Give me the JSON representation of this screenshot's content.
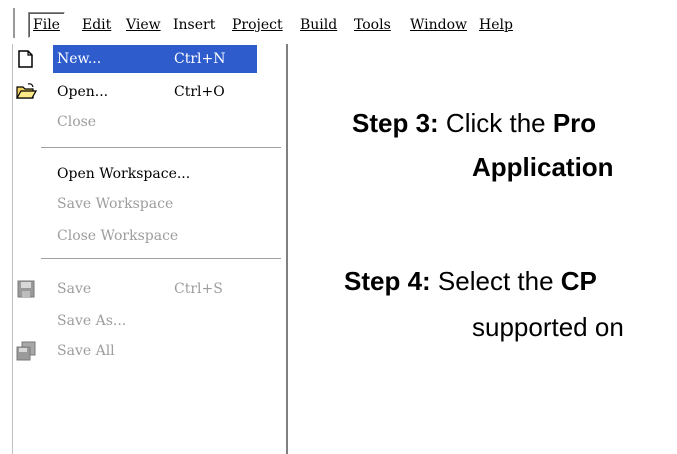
{
  "menubar": {
    "items": [
      {
        "label": "File",
        "mnemonic": "F"
      },
      {
        "label": "Edit",
        "mnemonic": "E"
      },
      {
        "label": "View",
        "mnemonic": "V"
      },
      {
        "label": "Insert",
        "mnemonic": ""
      },
      {
        "label": "Project",
        "mnemonic": "P"
      },
      {
        "label": "Build",
        "mnemonic": "B"
      },
      {
        "label": "Tools",
        "mnemonic": "T"
      },
      {
        "label": "Window",
        "mnemonic": "W"
      },
      {
        "label": "Help",
        "mnemonic": "H"
      }
    ]
  },
  "file_menu": {
    "new": {
      "label": "New...",
      "shortcut": "Ctrl+N"
    },
    "open": {
      "label": "Open...",
      "shortcut": "Ctrl+O"
    },
    "close": {
      "label": "Close"
    },
    "open_workspace": {
      "label": "Open Workspace..."
    },
    "save_workspace": {
      "label": "Save Workspace"
    },
    "close_workspace": {
      "label": "Close Workspace"
    },
    "save": {
      "label": "Save",
      "shortcut": "Ctrl+S"
    },
    "save_as": {
      "label": "Save As..."
    },
    "save_all": {
      "label": "Save All"
    }
  },
  "instructions": {
    "step3": {
      "prefix": "Step 3:",
      "text": "Click the ",
      "bold": "Pro",
      "line2": "Application"
    },
    "step4": {
      "prefix": "Step 4:",
      "text": "Select the ",
      "bold": "CP",
      "line2": "supported on"
    }
  },
  "colors": {
    "highlight": "#2e5ccd",
    "disabled_text": "#9d9d9d"
  }
}
